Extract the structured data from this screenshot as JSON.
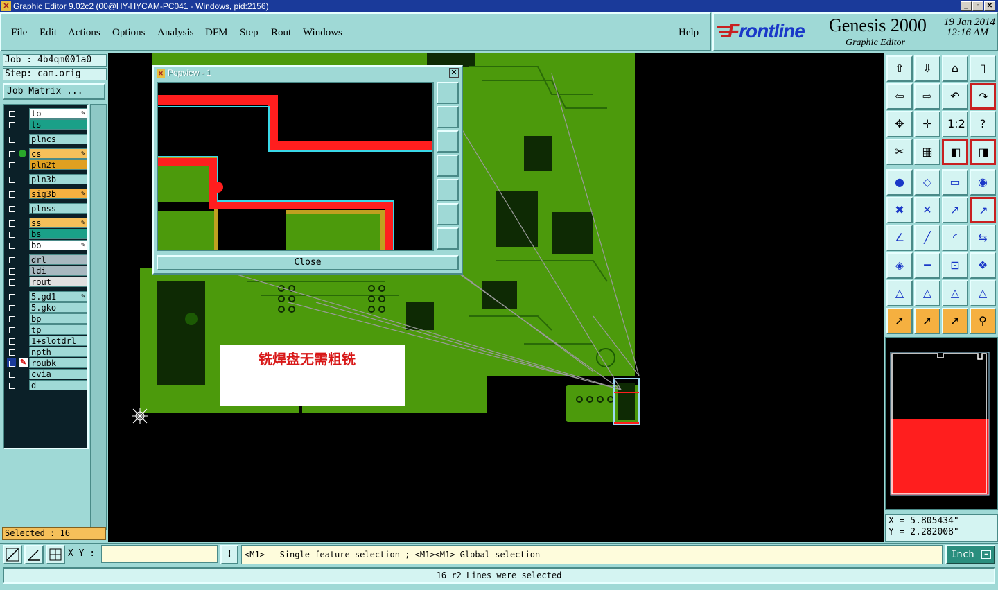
{
  "window": {
    "title": "Graphic Editor 9.02c2 (00@HY-HYCAM-PC041 - Windows, pid:2156)",
    "controls": [
      "_",
      "▫",
      "✕"
    ]
  },
  "menu": {
    "items": [
      "File",
      "Edit",
      "Actions",
      "Options",
      "Analysis",
      "DFM",
      "Step",
      "Rout",
      "Windows"
    ],
    "help": "Help"
  },
  "brand": {
    "logo": "Frontline",
    "product": "Genesis 2000",
    "subtitle": "Graphic Editor",
    "date": "19 Jan 2014",
    "time": "12:16 AM"
  },
  "job": {
    "job_line": "Job : 4b4qm001a0",
    "step_line": "Step: cam.orig",
    "matrix_button": "Job Matrix ..."
  },
  "layers": [
    {
      "name": "to",
      "color": "#ffffff",
      "editable": true
    },
    {
      "name": "ts",
      "color": "#1aa088",
      "editable": false
    },
    {
      "name": "plncs",
      "color": "#9fd9d6",
      "editable": false
    },
    {
      "name": "cs",
      "color": "#f5c05a",
      "editable": true,
      "active": true
    },
    {
      "name": "pln2t",
      "color": "#e0a020",
      "editable": false
    },
    {
      "name": "pln3b",
      "color": "#9fd9d6",
      "editable": false
    },
    {
      "name": "sig3b",
      "color": "#f5b040",
      "editable": true
    },
    {
      "name": "plnss",
      "color": "#9fd9d6",
      "editable": false
    },
    {
      "name": "ss",
      "color": "#f5c05a",
      "editable": true
    },
    {
      "name": "bs",
      "color": "#1aa088",
      "editable": false
    },
    {
      "name": "bo",
      "color": "#ffffff",
      "editable": true
    },
    {
      "name": "drl",
      "color": "#a8b8c0",
      "editable": false
    },
    {
      "name": "ldi",
      "color": "#a8b8c0",
      "editable": false
    },
    {
      "name": "rout",
      "color": "#e0e0e0",
      "editable": false
    },
    {
      "name": "5.gd1",
      "color": "#9fd9d6",
      "editable": true
    },
    {
      "name": "5.gko",
      "color": "#9fd9d6",
      "editable": false
    },
    {
      "name": "bp",
      "color": "#9fd9d6",
      "editable": false
    },
    {
      "name": "tp",
      "color": "#9fd9d6",
      "editable": false
    },
    {
      "name": "1+slotdrl",
      "color": "#9fd9d6",
      "editable": false
    },
    {
      "name": "npth",
      "color": "#9fd9d6",
      "editable": false
    },
    {
      "name": "roubk",
      "color": "#9fd9d6",
      "editable": false,
      "work": true
    },
    {
      "name": "cvia",
      "color": "#9fd9d6",
      "editable": false
    },
    {
      "name": "d",
      "color": "#9fd9d6",
      "editable": false
    }
  ],
  "selected_count": "Selected : 16",
  "popview": {
    "title": "Popview - 1",
    "close_label": "Close"
  },
  "annotation": {
    "text": "铣焊盘无需粗铣"
  },
  "coords": {
    "x": "X = 5.805434\"",
    "y": "Y = 2.282008\""
  },
  "bottom": {
    "xy_label": "X Y :",
    "xy_value": "",
    "bang": "!",
    "prompt": "<M1> - Single feature selection ; <M1><M1> Global selection",
    "unit": "Inch"
  },
  "status": {
    "message": "16 r2 Lines were selected"
  },
  "toolbar_icons": [
    "step-up-icon",
    "step-down-icon",
    "home-icon",
    "panel-icon",
    "step-left-icon",
    "step-right-icon",
    "undo-icon",
    "redo-icon",
    "fit-icon",
    "center-icon",
    "scale-icon",
    "help-icon",
    "snap-icon",
    "grid-icon",
    "layers-red-icon",
    "layers-red2-icon",
    "add-pad-icon",
    "add-surface-icon",
    "measure-icon",
    "pad-icon",
    "connect-icon",
    "delete-icon",
    "move-icon",
    "move-red-icon",
    "angle-icon",
    "line-icon",
    "arc-icon",
    "mirror-icon",
    "copy-icon",
    "break-icon",
    "resize-icon",
    "transform-icon",
    "fillet-icon",
    "chamfer-icon",
    "arc-fillet-icon",
    "arc-chamfer-icon",
    "select-icon",
    "select-box-icon",
    "select-poly-icon",
    "select-net-icon"
  ],
  "colors": {
    "panel": "#9fd9d6",
    "board": "#4c9a0c",
    "selection": "#ff1e1e",
    "accent": "#1a3a9a"
  }
}
